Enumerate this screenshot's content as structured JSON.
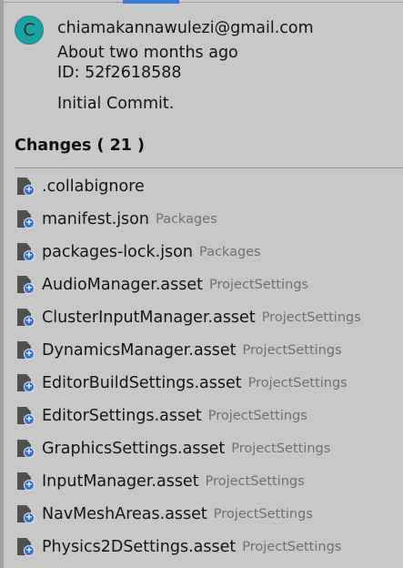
{
  "commit": {
    "avatar_initial": "C",
    "author": "chiamakannawulezi@gmail.com",
    "time_ago": "About two months ago",
    "id_label": "ID:",
    "id_value": "52f2618588",
    "message": "Initial Commit."
  },
  "changes": {
    "label": "Changes",
    "count_text": "( 21 )",
    "files": [
      {
        "name": ".collabignore",
        "path": ""
      },
      {
        "name": "manifest.json",
        "path": "Packages"
      },
      {
        "name": "packages-lock.json",
        "path": "Packages"
      },
      {
        "name": "AudioManager.asset",
        "path": "ProjectSettings"
      },
      {
        "name": "ClusterInputManager.asset",
        "path": "ProjectSettings"
      },
      {
        "name": "DynamicsManager.asset",
        "path": "ProjectSettings"
      },
      {
        "name": "EditorBuildSettings.asset",
        "path": "ProjectSettings"
      },
      {
        "name": "EditorSettings.asset",
        "path": "ProjectSettings"
      },
      {
        "name": "GraphicsSettings.asset",
        "path": "ProjectSettings"
      },
      {
        "name": "InputManager.asset",
        "path": "ProjectSettings"
      },
      {
        "name": "NavMeshAreas.asset",
        "path": "ProjectSettings"
      },
      {
        "name": "Physics2DSettings.asset",
        "path": "ProjectSettings"
      }
    ]
  },
  "icons": {
    "avatar": "avatar-circle",
    "file": "document-icon",
    "added": "plus-badge-icon"
  },
  "colors": {
    "background": "#c8c8c8",
    "avatar": "#1aa1a3",
    "added_badge": "#2f6fd0",
    "tab_accent": "#3b7bd1",
    "path_text": "#6f6f6f"
  }
}
